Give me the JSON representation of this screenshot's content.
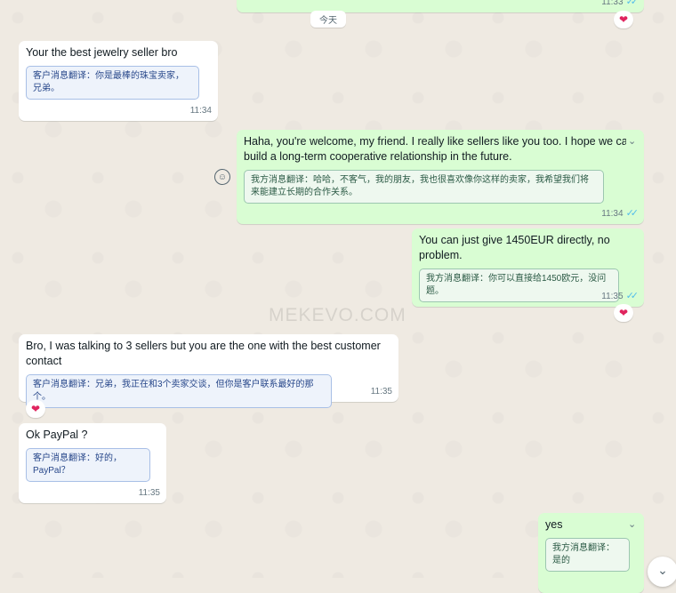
{
  "watermark": "MEKEVO.COM",
  "date_separator": "今天",
  "icons": {
    "heart": "❤",
    "double_tick": "✓✓",
    "chevron": "⌄",
    "emoji": "☺"
  },
  "colors": {
    "incoming_bubble": "#ffffff",
    "outgoing_bubble": "#d9fdd3",
    "background": "#efeae2",
    "read_ticks": "#53bdeb",
    "heart": "#e0245e"
  },
  "top_partial_message": {
    "time": "11:33"
  },
  "messages": [
    {
      "direction": "in",
      "text": "Your the best jewelry seller bro",
      "translation": "客户消息翻译：你是最棒的珠宝卖家，兄弟。",
      "time": "11:34"
    },
    {
      "direction": "out",
      "text": "Haha, you're welcome, my friend. I really like sellers like you too. I hope we can build a long-term cooperative relationship in the future.",
      "translation": "我方消息翻译：哈哈，不客气，我的朋友，我也很喜欢像你这样的卖家，我希望我们将来能建立长期的合作关系。",
      "time": "11:34"
    },
    {
      "direction": "out",
      "text": "You can just give 1450EUR directly, no problem.",
      "translation": "我方消息翻译：你可以直接给1450欧元，没问题。",
      "time": "11:35"
    },
    {
      "direction": "in",
      "text": "Bro, I was talking to 3 sellers but you are the one with the best customer contact",
      "translation": "客户消息翻译：兄弟，我正在和3个卖家交谈，但你是客户联系最好的那个。",
      "time": "11:35"
    },
    {
      "direction": "in",
      "text": "Ok PayPal ?",
      "translation": "客户消息翻译：好的，PayPal？",
      "time": "11:35"
    },
    {
      "direction": "out",
      "text": "yes",
      "translation": "我方消息翻译：是的",
      "time": ""
    }
  ]
}
